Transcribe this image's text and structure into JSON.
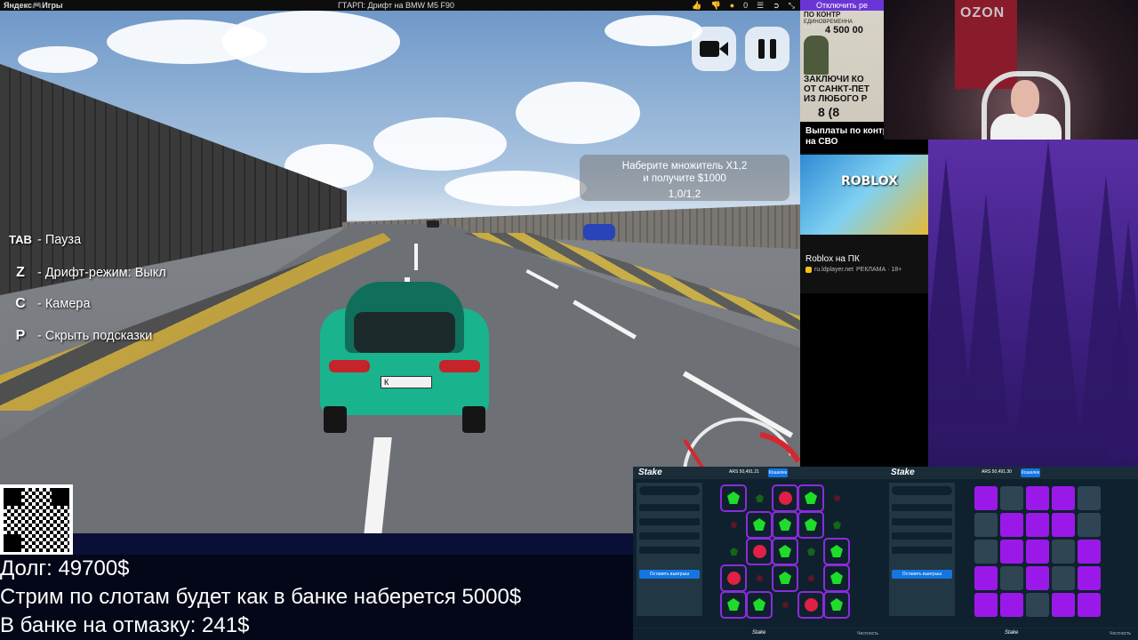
{
  "topbar": {
    "brand": "Яндекс🎮Игры",
    "game_title": "ГТАРП: Дрифт на BMW M5 F90",
    "icons": [
      "thumbs-up-icon",
      "thumbs-down-icon",
      "coin-icon",
      "menu-icon",
      "exit-icon",
      "fullscreen-icon"
    ],
    "coins": "0",
    "disable_ads": "Отключить ре"
  },
  "game": {
    "mission": {
      "line1": "Наберите множитель X1,2",
      "line2": "и получите $1000",
      "progress": "1,0/1,2"
    },
    "hints": [
      {
        "key": "TAB",
        "text": "- Пауза"
      },
      {
        "key": "Z",
        "text": "- Дрифт-режим: Выкл"
      },
      {
        "key": "C",
        "text": "- Камера"
      },
      {
        "key": "P",
        "text": "- Скрыть подсказки"
      }
    ],
    "plate": "К"
  },
  "ads": {
    "ad1": {
      "tag": "ПО КОНТР",
      "sub": "ЕДИНОВРЕМЕННА",
      "sum": "4 500 00",
      "headline1": "ЗАКЛЮЧИ КО",
      "headline2": "ОТ САНКТ-ПЕТ",
      "headline3": "ИЗ ЛЮБОГО Р",
      "number": "8 (8",
      "caption1": "Выплаты по контр",
      "caption2": "на СВО"
    },
    "ad2": {
      "image_text": "ROBLOX",
      "title": "Roblox на ПК",
      "source": "ru.ldplayer.net",
      "label": "РЕКЛАМА · 18+"
    }
  },
  "webcam": {
    "banner": "OZON"
  },
  "ticker": {
    "line1": "Долг: 49700$",
    "line2": "Стрим по слотам будет как в банке наберется 5000$",
    "line3": "В банке на отмазку: 241$"
  },
  "stake": {
    "logo": "Stake",
    "wallet": "Кошелек",
    "panel1": {
      "balance": "ARS 50,491.21",
      "bet_button": "Оставить выигрыш"
    },
    "panel2": {
      "balance": "ARS 50,491.30",
      "bet_button": "Оставить выигрыш"
    },
    "footer_brand": "Stake",
    "fairness": "Честность",
    "board1": [
      "gem",
      "gem-dim",
      "bomb",
      "gem",
      "bomb-dim",
      "bomb-dim",
      "gem",
      "gem",
      "gem",
      "gem-dim",
      "gem-dim",
      "bomb",
      "gem",
      "gem-dim",
      "gem",
      "bomb",
      "bomb-dim",
      "gem",
      "bomb-dim",
      "gem",
      "gem",
      "gem",
      "bomb-dim",
      "bomb",
      "gem"
    ],
    "board1_selected": [
      0,
      2,
      3,
      6,
      7,
      8,
      11,
      12,
      14,
      15,
      17,
      19,
      20,
      21,
      23,
      24
    ],
    "board2": [
      "purple",
      "gray",
      "purple",
      "purple",
      "gray",
      "gray",
      "purple",
      "purple",
      "purple",
      "gray",
      "gray",
      "purple",
      "purple",
      "gray",
      "purple",
      "purple",
      "gray",
      "purple",
      "gray",
      "purple",
      "purple",
      "purple",
      "gray",
      "purple",
      "purple"
    ]
  }
}
